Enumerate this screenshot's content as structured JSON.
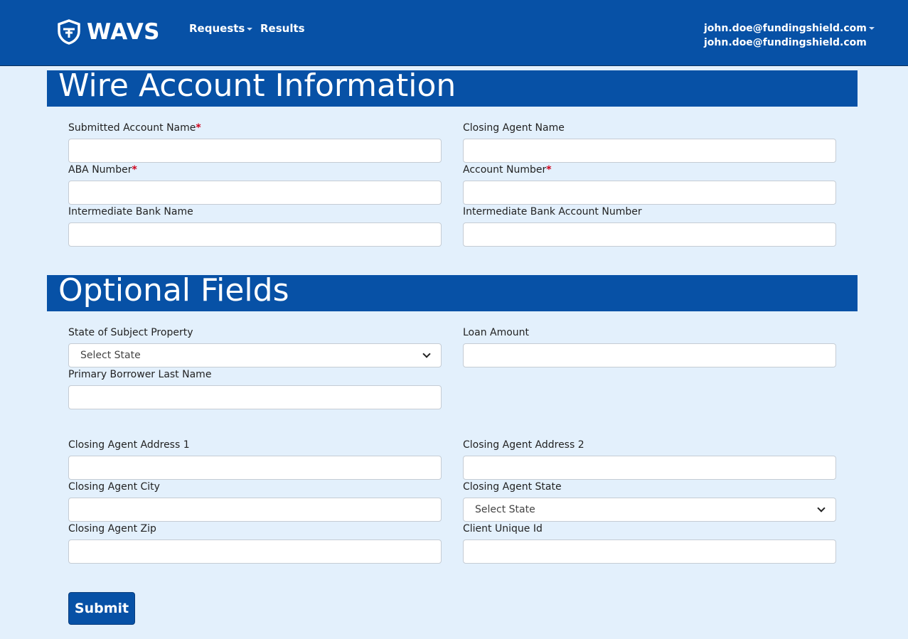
{
  "nav": {
    "brand": "WAVS",
    "requests": "Requests",
    "results": "Results",
    "user_email": "john.doe@fundingshield.com",
    "user_email_secondary": "john.doe@fundingshield.com"
  },
  "wire_section": {
    "title": "Wire Account Information",
    "submitted_account_name": "Submitted Account Name",
    "closing_agent_name": "Closing Agent Name",
    "aba_number": "ABA Number",
    "account_number": "Account Number",
    "intermediate_bank_name": "Intermediate Bank Name",
    "intermediate_bank_account_number": "Intermediate Bank Account Number",
    "required_mark": "*"
  },
  "optional_section": {
    "title": "Optional Fields",
    "state_of_subject_property": "State of Subject Property",
    "state_select_value": "Select State",
    "loan_amount": "Loan Amount",
    "primary_borrower_last_name": "Primary Borrower Last Name",
    "closing_agent_address_1": "Closing Agent Address 1",
    "closing_agent_address_2": "Closing Agent Address 2",
    "closing_agent_city": "Closing Agent City",
    "closing_agent_state": "Closing Agent State",
    "closing_agent_state_value": "Select State",
    "closing_agent_zip": "Closing Agent Zip",
    "client_unique_id": "Client Unique Id"
  },
  "submit_label": "Submit",
  "colors": {
    "brand_blue": "#0751a6",
    "page_background": "#e3f0fc",
    "required": "#d0021b"
  }
}
